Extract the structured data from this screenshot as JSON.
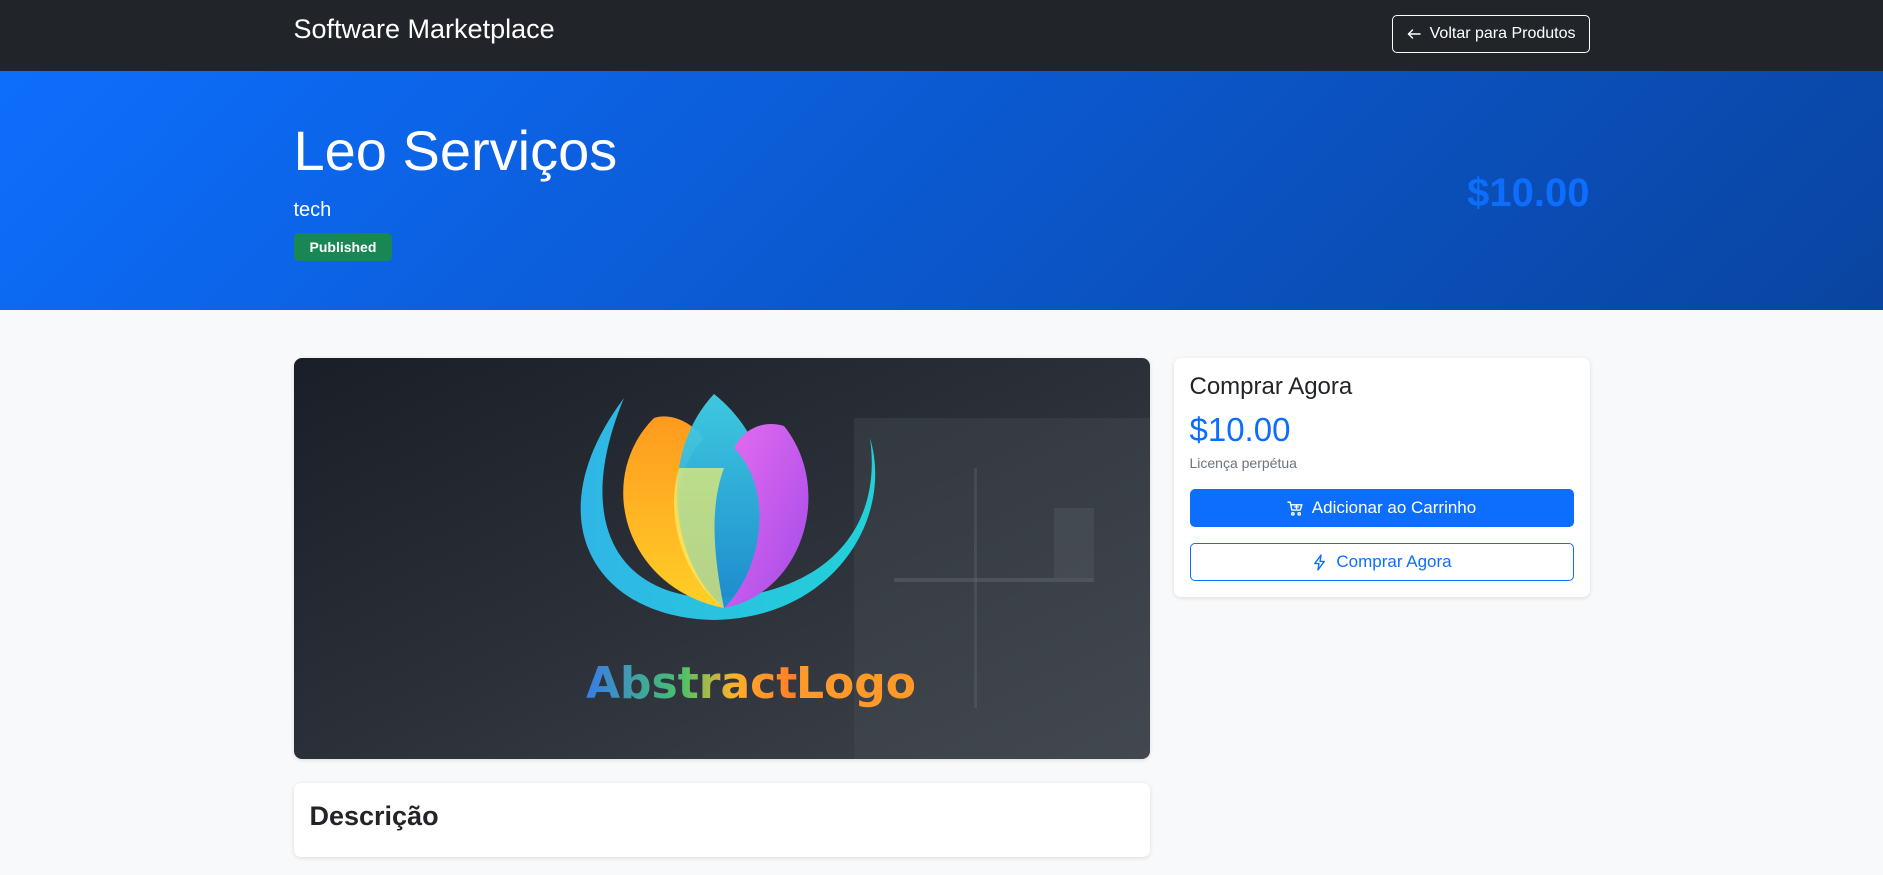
{
  "navbar": {
    "brand": "Software Marketplace",
    "back_label": "Voltar para Produtos",
    "back_icon": "arrow-left-icon"
  },
  "hero": {
    "title": "Leo Serviços",
    "category": "tech",
    "status": "Published",
    "price": "$10.00"
  },
  "product_image": {
    "logo_text_1": "Abstract",
    "logo_text_2": "Logo"
  },
  "purchase": {
    "title": "Comprar Agora",
    "price": "$10.00",
    "license": "Licença perpétua",
    "add_to_cart_label": "Adicionar ao Carrinho",
    "add_to_cart_icon": "cart-icon",
    "buy_now_label": "Comprar Agora",
    "buy_now_icon": "lightning-icon"
  },
  "description": {
    "title": "Descrição"
  },
  "colors": {
    "navbar_bg": "#212529",
    "primary": "#0d6efd",
    "success": "#198754",
    "page_bg": "#f8f9fa"
  }
}
